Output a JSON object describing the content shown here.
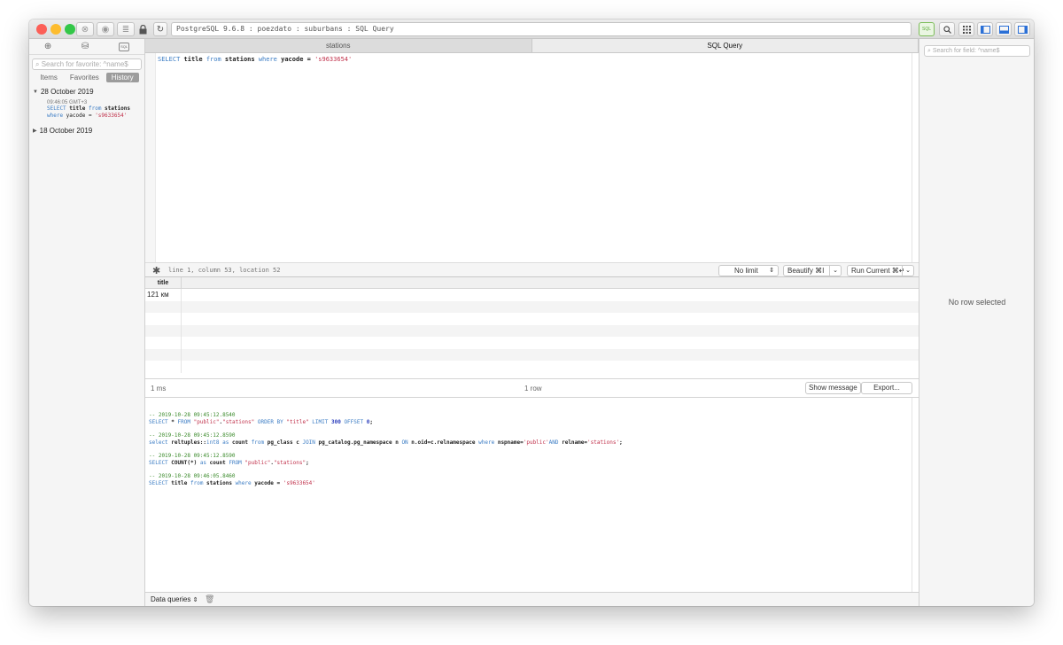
{
  "window": {
    "connection": "PostgreSQL 9.6.8 : poezdato : suburbans : SQL Query",
    "badge": "SQL"
  },
  "sidebar": {
    "search_placeholder": "Search for favorite: ^name$",
    "tabs": [
      "Items",
      "Favorites",
      "History"
    ],
    "active_tab": "History",
    "groups": [
      {
        "label": "28 October 2019",
        "expanded": true,
        "entries": [
          {
            "time": "09:46:05 GMT+3",
            "line1_kw": "SELECT",
            "line1_rest": " title ",
            "line1_kw2": "from",
            "line1_rest2": " stations",
            "line2_kw": "where",
            "line2_rest": " yacode = ",
            "line2_str": "'s9633654'"
          }
        ]
      },
      {
        "label": "18 October 2019",
        "expanded": false
      }
    ]
  },
  "tabs": [
    "stations",
    "SQL Query"
  ],
  "active_tab": "SQL Query",
  "editor": {
    "k1": "SELECT",
    "t1": " title ",
    "k2": "from",
    "t2": " stations ",
    "k3": "where",
    "t3": " yacode = ",
    "s1": "'s9633654'"
  },
  "editor_status": {
    "position": "line 1, column 53, location 52",
    "limit": "No limit",
    "beautify": "Beautify ⌘I",
    "run": "Run Current ⌘↵"
  },
  "results": {
    "column": "title",
    "rows": [
      "121 км"
    ],
    "time": "1 ms",
    "row_count": "1 row",
    "show_message": "Show message",
    "export": "Export..."
  },
  "log": [
    {
      "comment": "-- 2019-10-28 09:45:12.8540",
      "parts": [
        [
          "kw",
          "SELECT "
        ],
        [
          "op",
          "*"
        ],
        [
          "kw",
          " FROM "
        ],
        [
          "str",
          "\"public\""
        ],
        [
          "op",
          "."
        ],
        [
          "str",
          "\"stations\""
        ],
        [
          "kw",
          " ORDER BY "
        ],
        [
          "str",
          "\"title\""
        ],
        [
          "kw",
          " LIMIT "
        ],
        [
          "num",
          "300"
        ],
        [
          "kw",
          " OFFSET "
        ],
        [
          "num",
          "0"
        ],
        [
          "op",
          ";"
        ]
      ]
    },
    {
      "comment": "-- 2019-10-28 09:45:12.8590",
      "parts": [
        [
          "kw",
          "select "
        ],
        [
          "op",
          "reltuples::"
        ],
        [
          "kw",
          "int8 as "
        ],
        [
          "op",
          "count "
        ],
        [
          "kw",
          "from "
        ],
        [
          "op",
          "pg_class c "
        ],
        [
          "kw",
          "JOIN "
        ],
        [
          "op",
          "pg_catalog.pg_namespace n "
        ],
        [
          "kw",
          "ON "
        ],
        [
          "op",
          "n.oid=c.relnamespace "
        ],
        [
          "kw",
          "where "
        ],
        [
          "op",
          "nspname="
        ],
        [
          "str",
          "'public'"
        ],
        [
          "kw",
          "AND "
        ],
        [
          "op",
          "relname="
        ],
        [
          "str",
          "'stations'"
        ],
        [
          "op",
          ";"
        ]
      ]
    },
    {
      "comment": "-- 2019-10-28 09:45:12.8590",
      "parts": [
        [
          "kw",
          "SELECT "
        ],
        [
          "op",
          "COUNT(*) "
        ],
        [
          "kw",
          "as "
        ],
        [
          "op",
          "count "
        ],
        [
          "kw",
          "FROM "
        ],
        [
          "str",
          "\"public\""
        ],
        [
          "op",
          "."
        ],
        [
          "str",
          "\"stations\""
        ],
        [
          "op",
          ";"
        ]
      ]
    },
    {
      "comment": "-- 2019-10-28 09:46:05.8460",
      "parts": [
        [
          "kw",
          "SELECT "
        ],
        [
          "op",
          "title "
        ],
        [
          "kw",
          "from "
        ],
        [
          "op",
          "stations "
        ],
        [
          "kw",
          "where "
        ],
        [
          "op",
          "yacode = "
        ],
        [
          "str",
          "'s9633654'"
        ]
      ]
    }
  ],
  "bottom": {
    "label": "Data queries"
  },
  "right_panel": {
    "search_placeholder": "Search for field: ^name$",
    "empty_text": "No row selected"
  },
  "colors": {
    "close": "#fc5f57",
    "minimize": "#fdbc2e",
    "zoom": "#33c748",
    "keyword": "#3b7cc4",
    "string": "#c0304a",
    "comment": "#3a8a2a",
    "sql_badge": "#5aa83a"
  }
}
